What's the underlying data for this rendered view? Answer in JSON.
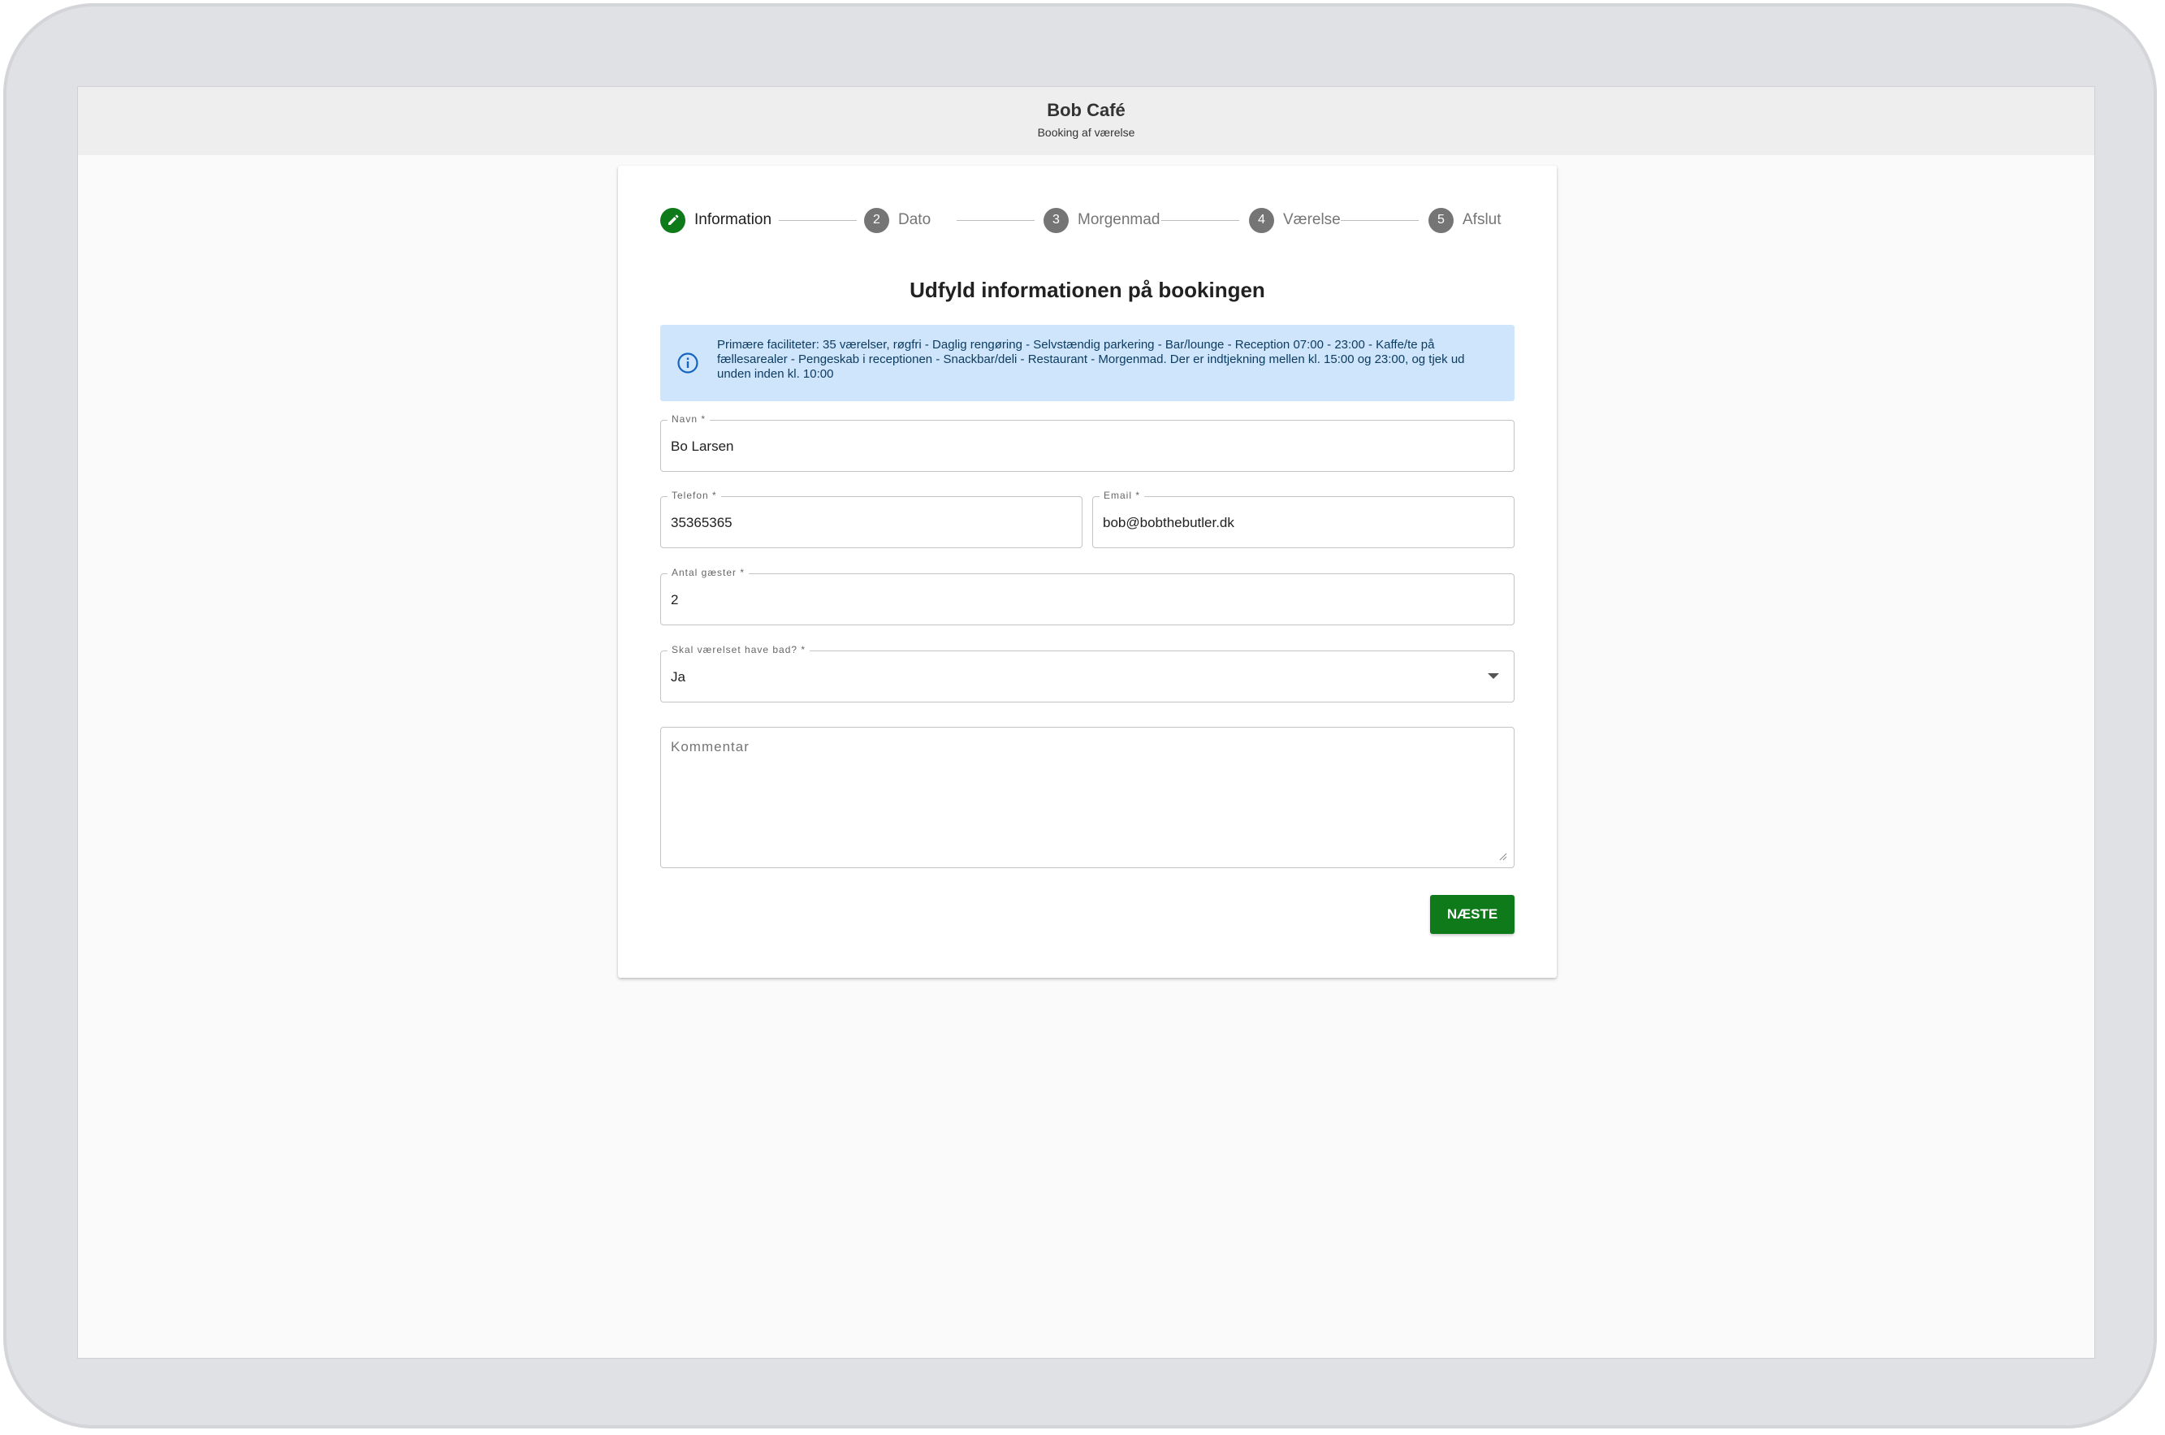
{
  "header": {
    "title": "Bob Café",
    "subtitle": "Booking af værelse"
  },
  "stepper": {
    "steps": [
      {
        "number": "",
        "label": "Information",
        "state": "active",
        "icon": "pencil-icon"
      },
      {
        "number": "2",
        "label": "Dato",
        "state": "pending"
      },
      {
        "number": "3",
        "label": "Morgenmad",
        "state": "pending"
      },
      {
        "number": "4",
        "label": "Værelse",
        "state": "pending"
      },
      {
        "number": "5",
        "label": "Afslut",
        "state": "pending"
      }
    ]
  },
  "form": {
    "heading": "Udfyld informationen på bookingen",
    "info": {
      "icon": "info-icon",
      "text": "Primære faciliteter: 35 værelser, røgfri - Daglig rengøring - Selvstændig parkering - Bar/lounge - Reception 07:00 - 23:00 - Kaffe/te på fællesarealer - Pengeskab i receptionen - Snackbar/deli - Restaurant - Morgenmad. Der er indtjekning mellen kl. 15:00 og 23:00, og tjek ud unden inden kl. 10:00"
    },
    "name": {
      "label": "Navn *",
      "value": "Bo Larsen"
    },
    "phone": {
      "label": "Telefon *",
      "value": "35365365"
    },
    "email": {
      "label": "Email *",
      "value": "bob@bobthebutler.dk"
    },
    "guests": {
      "label": "Antal gæster *",
      "value": "2"
    },
    "bath": {
      "label": "Skal værelset have bad? *",
      "value": "Ja"
    },
    "comment": {
      "placeholder": "Kommentar",
      "value": ""
    },
    "next_label": "NÆSTE"
  },
  "colors": {
    "accent": "#0f7a1a",
    "info_bg": "#cfe5fb",
    "info_text": "#0d3c61",
    "step_inactive": "#757575"
  }
}
